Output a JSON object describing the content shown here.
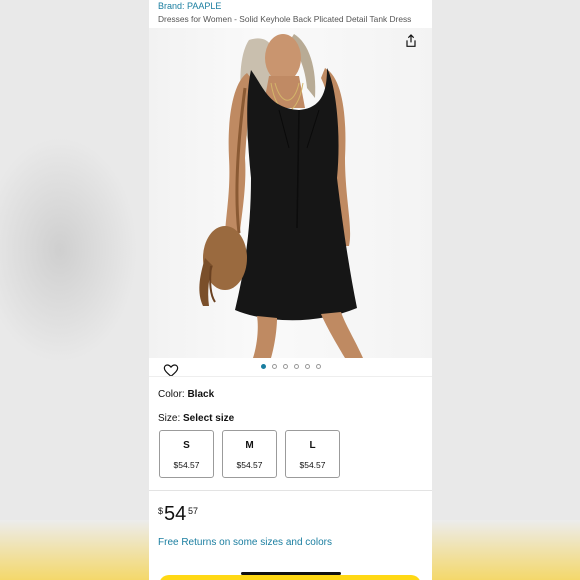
{
  "brand": "Brand: PAAPLE",
  "title": "Dresses for Women - Solid Keyhole Back Plicated Detail Tank Dress",
  "colors": {
    "link": "#1a7ea0",
    "dress": "#161616",
    "cart_button": "#ffd814"
  },
  "icons": {
    "share": "share-icon",
    "wishlist": "heart-icon"
  },
  "image_carousel": {
    "total": 6,
    "active_index": 0
  },
  "color": {
    "label": "Color: ",
    "value": "Black"
  },
  "size": {
    "label": "Size: ",
    "value": "Select size",
    "options": [
      {
        "name": "S",
        "price": "$54.57"
      },
      {
        "name": "M",
        "price": "$54.57"
      },
      {
        "name": "L",
        "price": "$54.57"
      }
    ]
  },
  "price": {
    "symbol": "$",
    "whole": "54",
    "fraction": "57"
  },
  "free_returns": "Free Returns on some sizes and colors"
}
